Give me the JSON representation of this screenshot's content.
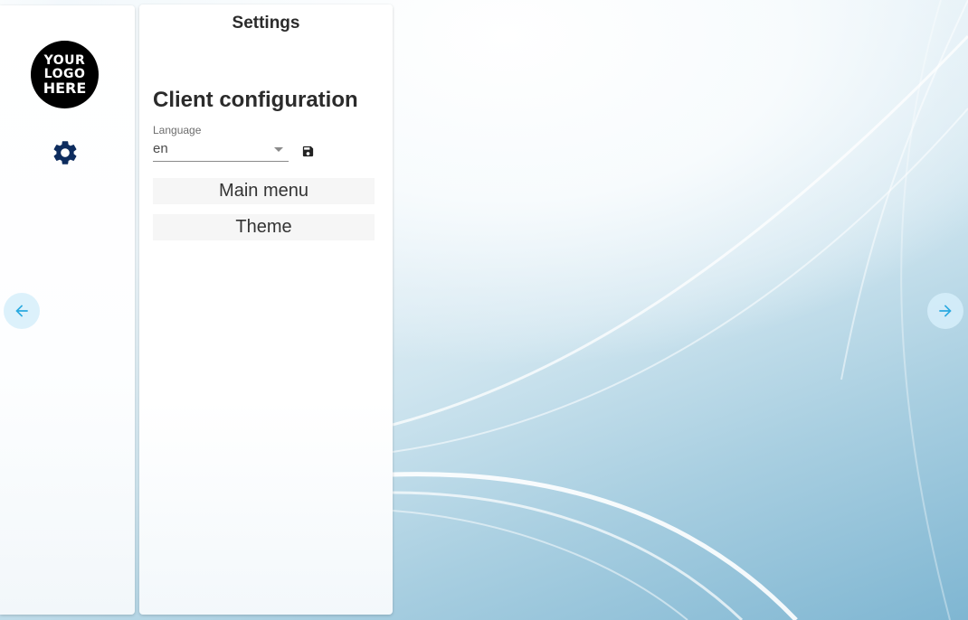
{
  "logo": {
    "lines": [
      "YOUR",
      "LOGO",
      "HERE"
    ]
  },
  "sidebar": {
    "settings_icon": "gear-icon"
  },
  "settings_panel": {
    "title": "Settings",
    "section_title": "Client configuration",
    "language": {
      "label": "Language",
      "value": "en"
    },
    "save_icon": "floppy-disk-icon",
    "buttons": [
      {
        "label": "Main menu"
      },
      {
        "label": "Theme"
      }
    ]
  },
  "navigation": {
    "prev_icon": "arrow-left-icon",
    "next_icon": "arrow-right-icon"
  },
  "colors": {
    "gear": "#0d2c5e",
    "nav_arrow": "#29a9e0",
    "nav_bg": "#d6eefa"
  }
}
